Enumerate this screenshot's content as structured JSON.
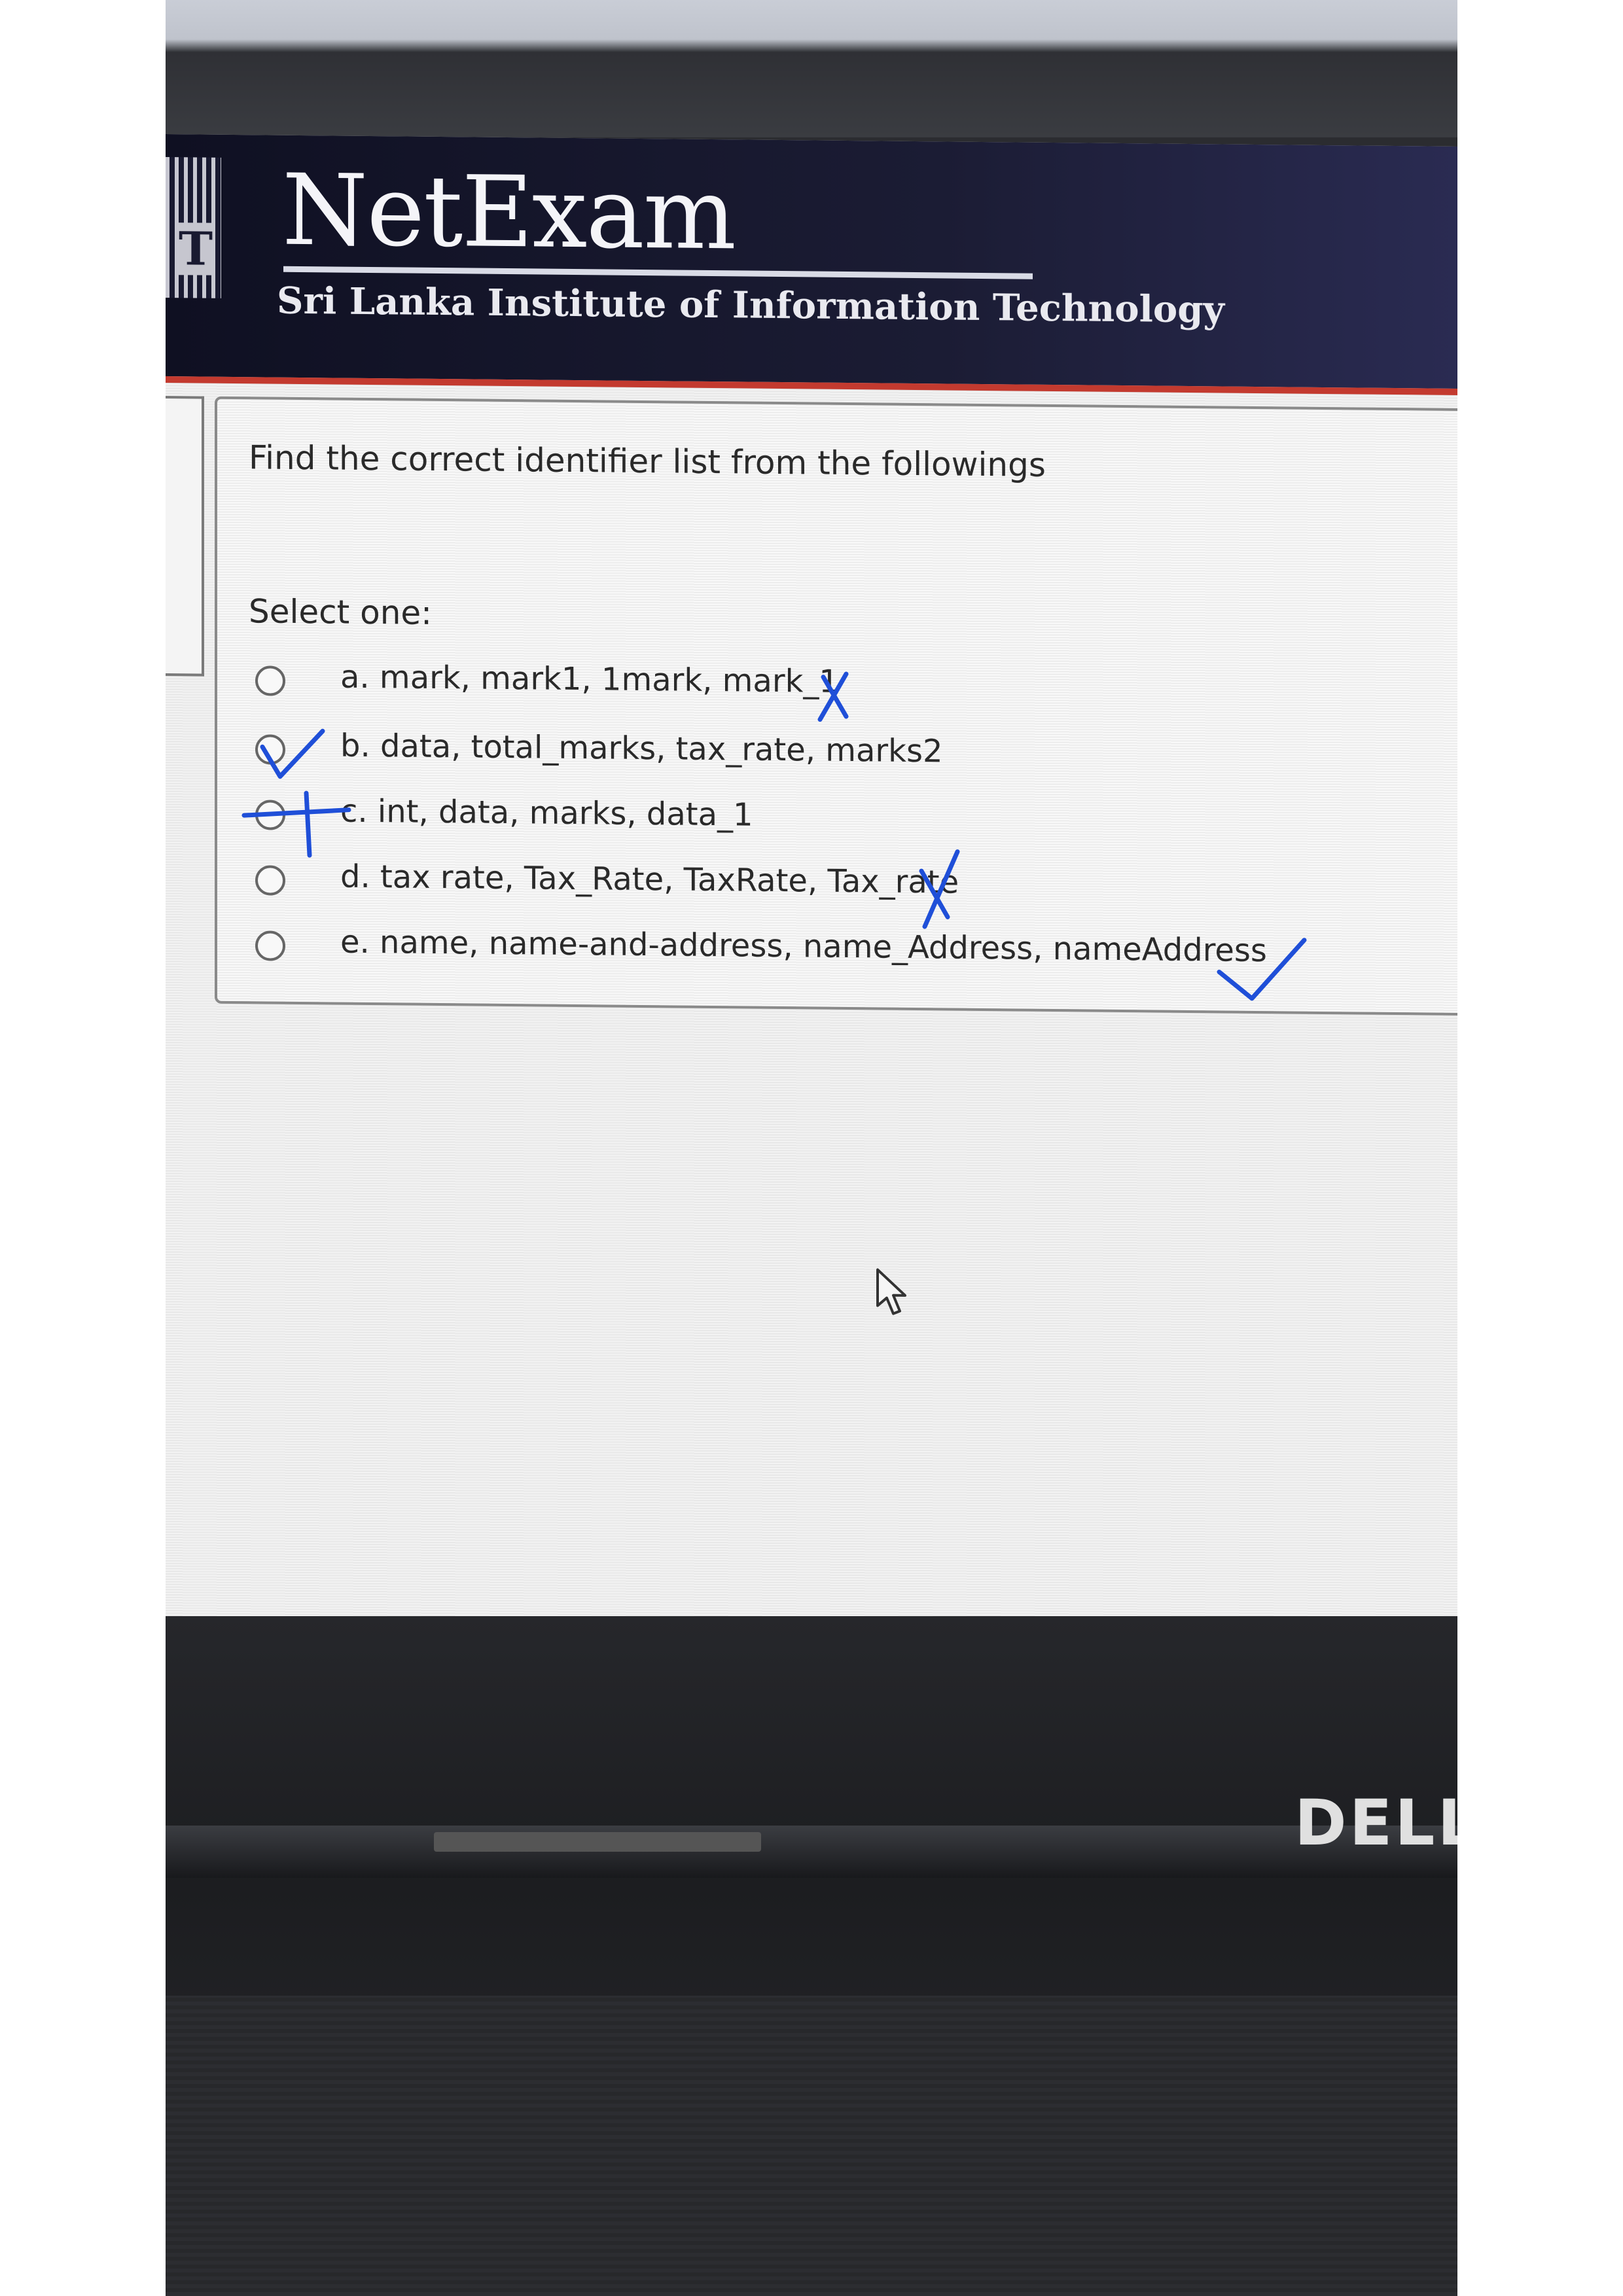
{
  "header": {
    "app_title": "NetExam",
    "institute": "Sri Lanka Institute of Information Technology"
  },
  "question": {
    "prompt": "Find the correct identifier list from the followings",
    "select_label": "Select one:",
    "options": [
      {
        "label": "a. mark, mark1, 1mark, mark_1",
        "annotation": "cross"
      },
      {
        "label": "b. data, total_marks, tax_rate, marks2",
        "annotation": "tick"
      },
      {
        "label": "c. int, data, marks, data_1",
        "annotation": "strike"
      },
      {
        "label": "d. tax rate, Tax_Rate, TaxRate, Tax_rate",
        "annotation": "cross"
      },
      {
        "label": "e. name, name-and-address, name_Address, nameAddress",
        "annotation": "tick"
      }
    ]
  },
  "device": {
    "brand": "DELL"
  },
  "colors": {
    "header_bg": "#1b1c34",
    "header_accent": "#c33a2f",
    "pen_ink": "#1f4fd8"
  },
  "icons": [
    "radio-button",
    "mouse-pointer-icon",
    "logo-icon"
  ]
}
